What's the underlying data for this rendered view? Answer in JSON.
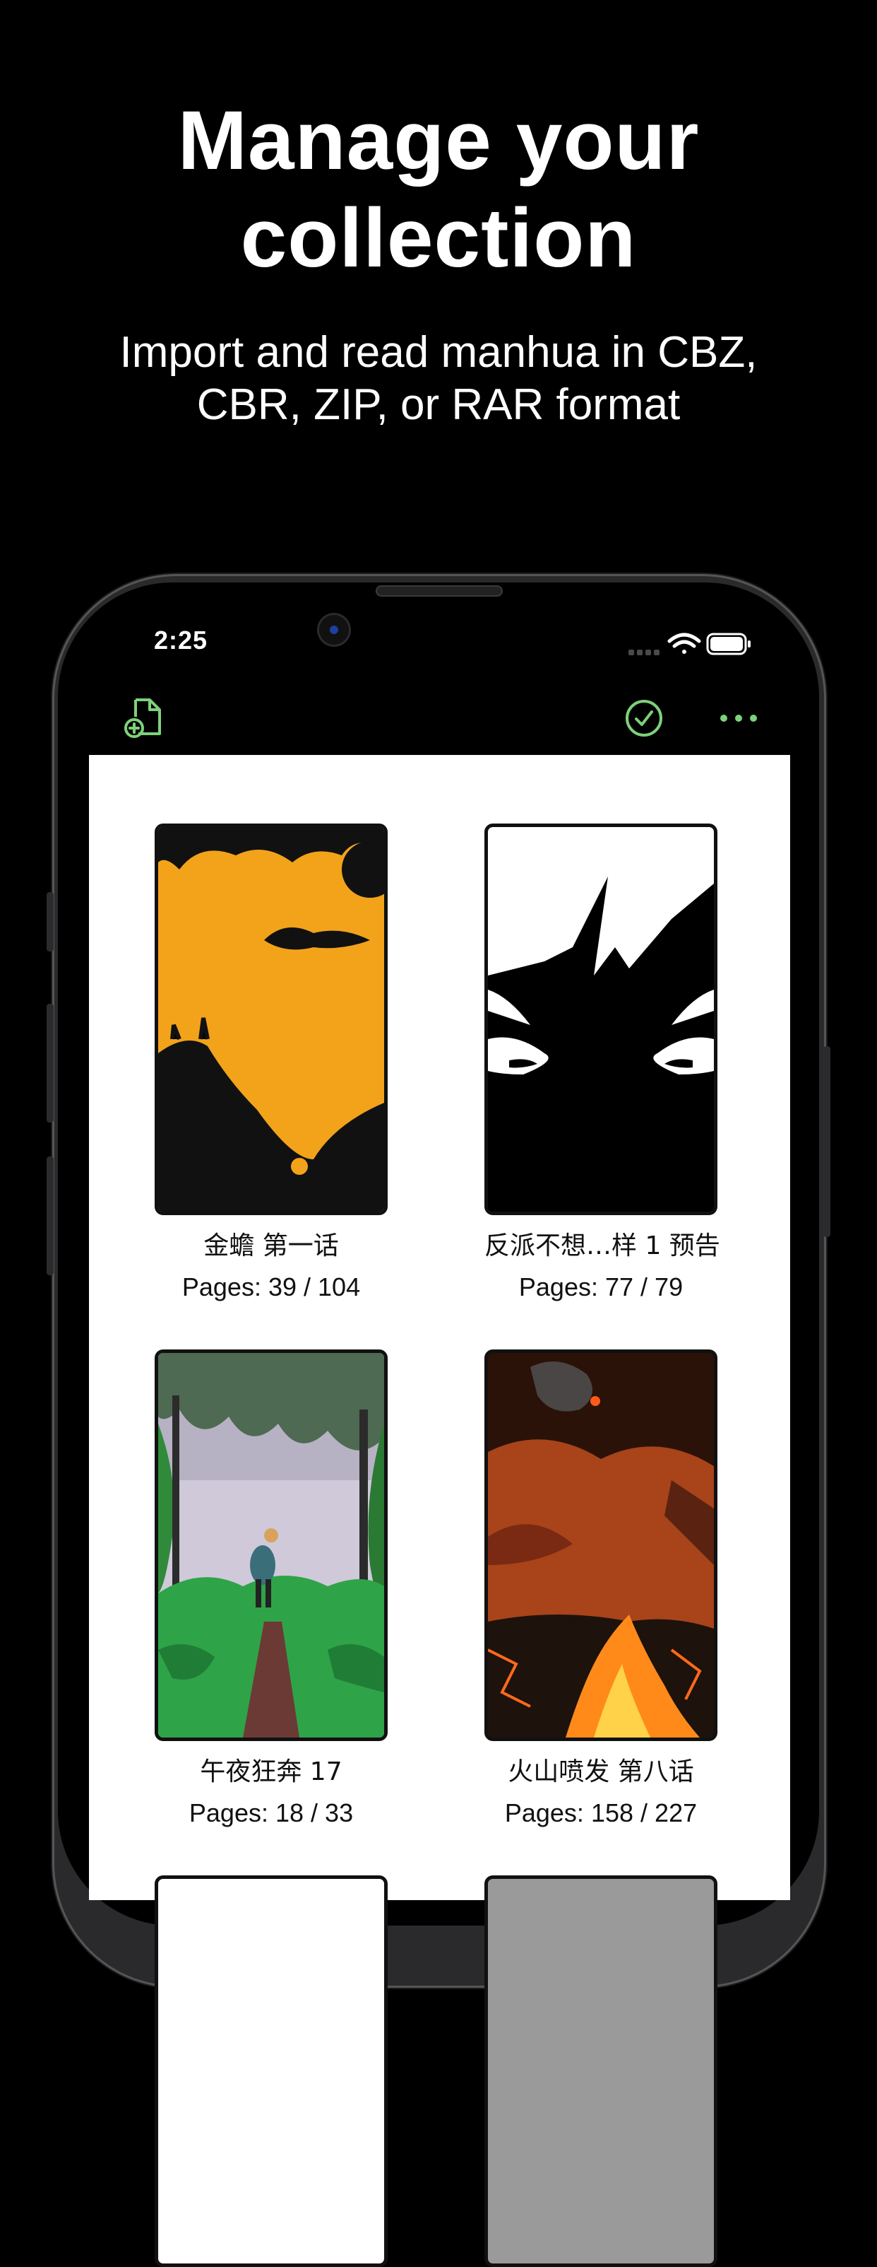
{
  "promo": {
    "headline_line1": "Manage your",
    "headline_line2": "collection",
    "subline_line1": "Import and read manhua in CBZ,",
    "subline_line2": "CBR, ZIP, or RAR format"
  },
  "status_bar": {
    "time": "2:25",
    "icons": [
      "signal-icon",
      "wifi-icon",
      "battery-icon"
    ]
  },
  "toolbar": {
    "left_icon": "import-file-icon",
    "right_icons": [
      "select-checkmark-icon",
      "more-ellipsis-icon"
    ],
    "accent_color": "#7ed17a"
  },
  "pages_prefix": "Pages: ",
  "library": {
    "items": [
      {
        "title": "金蟾 第一话",
        "pages_read": "39",
        "pages_total": "104"
      },
      {
        "title": "反派不想…样 1 预告",
        "pages_read": "77",
        "pages_total": "79"
      },
      {
        "title": "午夜狂奔 17",
        "pages_read": "18",
        "pages_total": "33"
      },
      {
        "title": "火山喷发 第八话",
        "pages_read": "158",
        "pages_total": "227"
      }
    ]
  }
}
